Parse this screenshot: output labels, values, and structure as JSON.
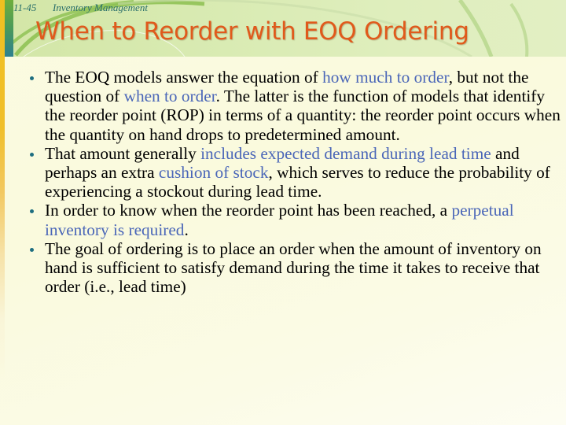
{
  "header": {
    "slide_number": "11-45",
    "section": "Inventory Management",
    "title": "When to Reorder with EOQ Ordering"
  },
  "colors": {
    "title": "#e05a1c",
    "highlight": "#4a66b8",
    "bullet": "#1e6e80",
    "header_text": "#2a6f6a"
  },
  "bullets": [
    {
      "segments": [
        {
          "text": "The EOQ models answer the equation of ",
          "highlight": false
        },
        {
          "text": "how much to order",
          "highlight": true
        },
        {
          "text": ", but not the question of ",
          "highlight": false
        },
        {
          "text": "when to order",
          "highlight": true
        },
        {
          "text": ". The latter is the function of models that identify the reorder point (ROP) in terms of a quantity: the reorder point occurs when the quantity on hand drops to predetermined amount.",
          "highlight": false
        }
      ]
    },
    {
      "segments": [
        {
          "text": "That amount generally ",
          "highlight": false
        },
        {
          "text": "includes expected demand during lead time",
          "highlight": true
        },
        {
          "text": " and perhaps an extra ",
          "highlight": false
        },
        {
          "text": "cushion of stock",
          "highlight": true
        },
        {
          "text": ", which serves to reduce the probability of experiencing a stockout during lead time.",
          "highlight": false
        }
      ]
    },
    {
      "segments": [
        {
          "text": "In order to know when the reorder point has been reached, a ",
          "highlight": false
        },
        {
          "text": "perpetual inventory is required",
          "highlight": true
        },
        {
          "text": ".",
          "highlight": false
        }
      ]
    },
    {
      "segments": [
        {
          "text": "The goal of ordering is to place an order when the amount of inventory on hand is sufficient to satisfy demand during the time it takes to receive that order (i.e., lead time)",
          "highlight": false
        }
      ]
    }
  ]
}
